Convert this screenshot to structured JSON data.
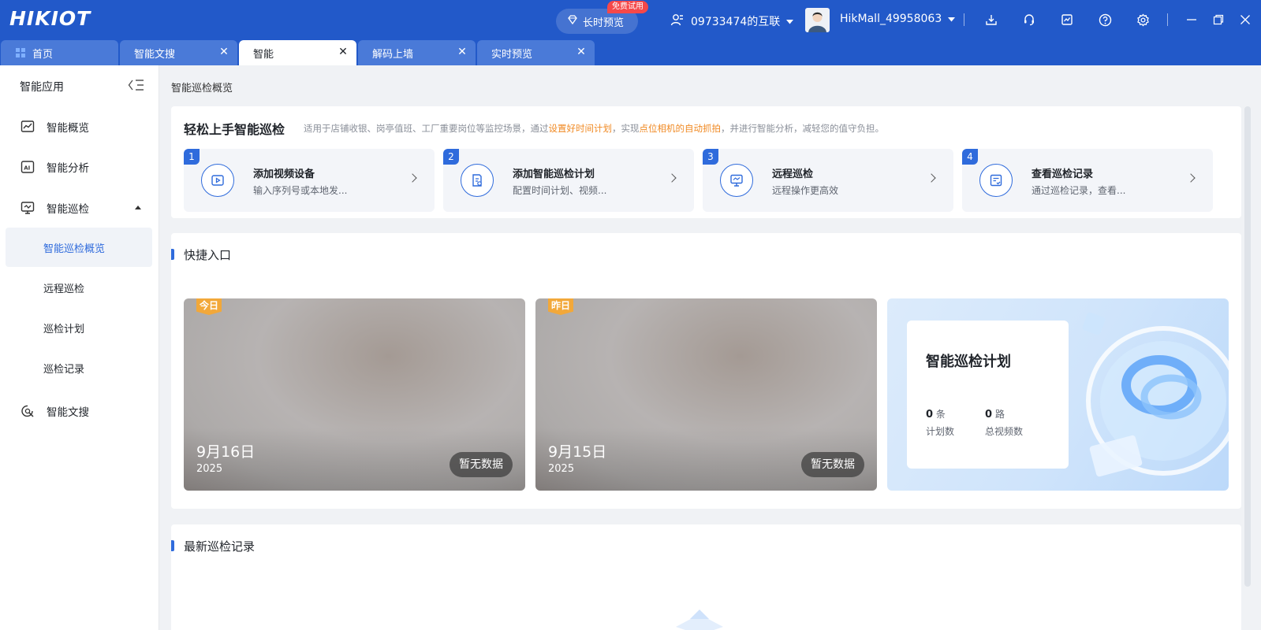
{
  "titlebar": {
    "logo": "HIKIOT",
    "live_preview": "长时预览",
    "free_trial": "免费试用",
    "account": "09733474的互联",
    "username": "HikMall_49958063"
  },
  "tabs": [
    {
      "label": "首页"
    },
    {
      "label": "智能文搜"
    },
    {
      "label": "智能"
    },
    {
      "label": "解码上墙"
    },
    {
      "label": "实时预览"
    }
  ],
  "tab_close": "✕",
  "sidebar": {
    "title": "智能应用",
    "items": [
      {
        "label": "智能概览"
      },
      {
        "label": "智能分析"
      },
      {
        "label": "智能巡检"
      },
      {
        "label": "智能文搜"
      }
    ],
    "sub_items": [
      {
        "label": "智能巡检概览"
      },
      {
        "label": "远程巡检"
      },
      {
        "label": "巡检计划"
      },
      {
        "label": "巡检记录"
      }
    ]
  },
  "breadcrumb": "智能巡检概览",
  "guide": {
    "title": "轻松上手智能巡检",
    "desc_1": "适用于店铺收银、岗亭值班、工厂重要岗位等监控场景，通过",
    "desc_hl_1": "设置好时间计划",
    "desc_2": "，实现",
    "desc_hl_2": "点位相机的自动抓拍",
    "desc_3": "，并进行智能分析，减轻您的值守负担。",
    "steps": [
      {
        "num": "1",
        "title": "添加视频设备",
        "sub": "输入序列号或本地发..."
      },
      {
        "num": "2",
        "title": "添加智能巡检计划",
        "sub": "配置时间计划、视频..."
      },
      {
        "num": "3",
        "title": "远程巡检",
        "sub": "远程操作更高效"
      },
      {
        "num": "4",
        "title": "查看巡检记录",
        "sub": "通过巡检记录，查看..."
      }
    ]
  },
  "quick": {
    "title": "快捷入口",
    "shots": [
      {
        "badge": "今日",
        "date": "9月16日",
        "year": "2025",
        "status": "暂无数据"
      },
      {
        "badge": "昨日",
        "date": "9月15日",
        "year": "2025",
        "status": "暂无数据"
      }
    ],
    "plan": {
      "title": "智能巡检计划",
      "count": "0",
      "count_unit": "条",
      "count_label": "计划数",
      "videos": "0",
      "videos_unit": "路",
      "videos_label": "总视频数"
    }
  },
  "latest": {
    "title": "最新巡检记录"
  },
  "colors": {
    "primary": "#2259c9",
    "accent": "#2f6bdc",
    "highlight": "#f08a24",
    "badge": "#f2a83a",
    "free_badge": "#f5484a"
  }
}
